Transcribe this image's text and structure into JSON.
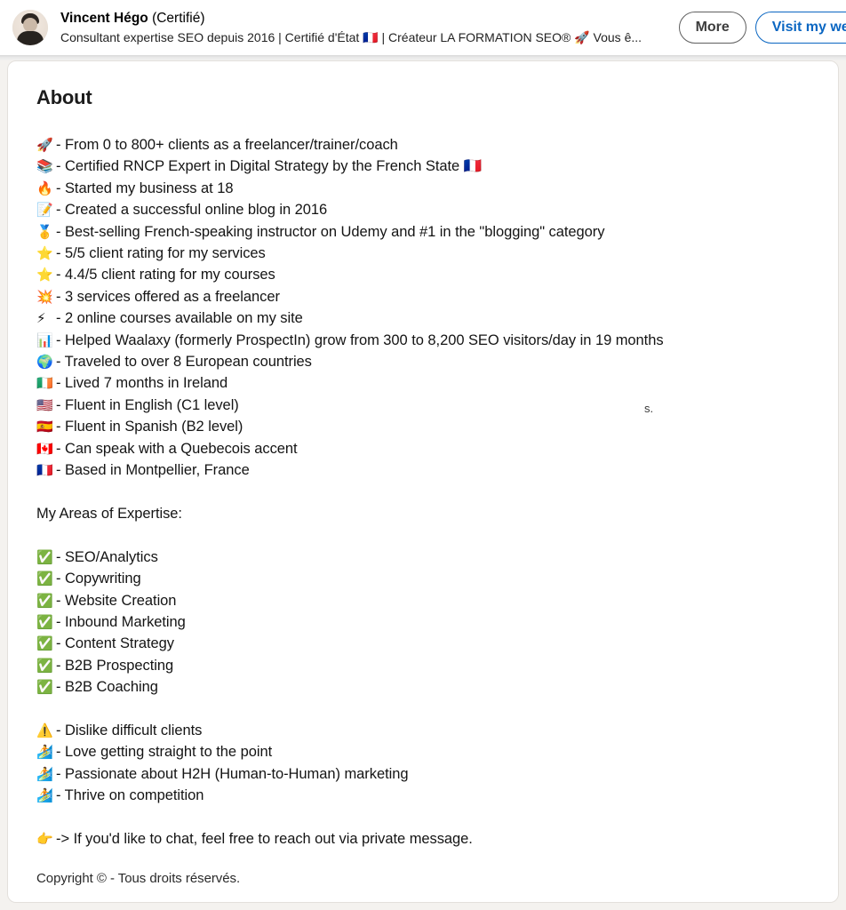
{
  "header": {
    "avatar_alt": "profile-photo",
    "name": "Vincent Hégo",
    "certified_suffix": "(Certifié)",
    "headline": "Consultant expertise SEO depuis 2016 | Certifié d'État 🇫🇷 | Créateur LA FORMATION SEO® 🚀 Vous ê...",
    "more_button": "More",
    "primary_button": "Visit my website"
  },
  "about": {
    "title": "About",
    "lines": [
      {
        "emoji": "🚀",
        "text": "- From 0 to 800+ clients as a freelancer/trainer/coach"
      },
      {
        "emoji": "📚",
        "text": "- Certified RNCP Expert in Digital Strategy by the French State 🇫🇷"
      },
      {
        "emoji": "🔥",
        "text": "- Started my business at 18"
      },
      {
        "emoji": "📝",
        "text": "- Created a successful online blog in 2016"
      },
      {
        "emoji": "🥇",
        "text": "- Best-selling French-speaking instructor on Udemy and #1 in the \"blogging\" category"
      },
      {
        "emoji": "⭐",
        "text": "- 5/5 client rating for my services"
      },
      {
        "emoji": "⭐",
        "text": "- 4.4/5 client rating for my courses"
      },
      {
        "emoji": "💥",
        "text": "- 3 services offered as a freelancer"
      },
      {
        "emoji": "⚡",
        "text": "- 2 online courses available on my site"
      },
      {
        "emoji": "📊",
        "text": "- Helped Waalaxy (formerly ProspectIn) grow from 300 to 8,200 SEO visitors/day in 19 months"
      },
      {
        "emoji": "🌍",
        "text": "- Traveled to over 8 European countries"
      },
      {
        "emoji": "🇮🇪",
        "text": "- Lived 7 months in Ireland"
      },
      {
        "emoji": "🇺🇸",
        "text": "- Fluent in English (C1 level)"
      },
      {
        "emoji": "🇪🇸",
        "text": "- Fluent in Spanish (B2 level)"
      },
      {
        "emoji": "🇨🇦",
        "text": "- Can speak with a Quebecois accent"
      },
      {
        "emoji": "🇫🇷",
        "text": "- Based in Montpellier, France"
      }
    ],
    "expertise_heading": "My Areas of Expertise:",
    "expertise": [
      {
        "emoji": "✅",
        "text": "- SEO/Analytics"
      },
      {
        "emoji": "✅",
        "text": "- Copywriting"
      },
      {
        "emoji": "✅",
        "text": "- Website Creation"
      },
      {
        "emoji": "✅",
        "text": "- Inbound Marketing"
      },
      {
        "emoji": "✅",
        "text": "- Content Strategy"
      },
      {
        "emoji": "✅",
        "text": "- B2B Prospecting"
      },
      {
        "emoji": "✅",
        "text": "- B2B Coaching"
      }
    ],
    "traits": [
      {
        "emoji": "⚠️",
        "text": "- Dislike difficult clients"
      },
      {
        "emoji": "🏄",
        "text": "- Love getting straight to the point"
      },
      {
        "emoji": "🏄",
        "text": "- Passionate about H2H (Human-to-Human) marketing"
      },
      {
        "emoji": "🏄",
        "text": "- Thrive on competition"
      }
    ],
    "cta": {
      "emoji": "👉",
      "text": "-> If you'd like to chat, feel free to reach out via private message."
    },
    "stray_fragment": "s.",
    "copyright": "Copyright © - Tous droits réservés."
  },
  "colors": {
    "accent": "#0a66c2",
    "page_bg": "#f4f2ef",
    "card_bg": "#ffffff",
    "text": "#141414"
  }
}
